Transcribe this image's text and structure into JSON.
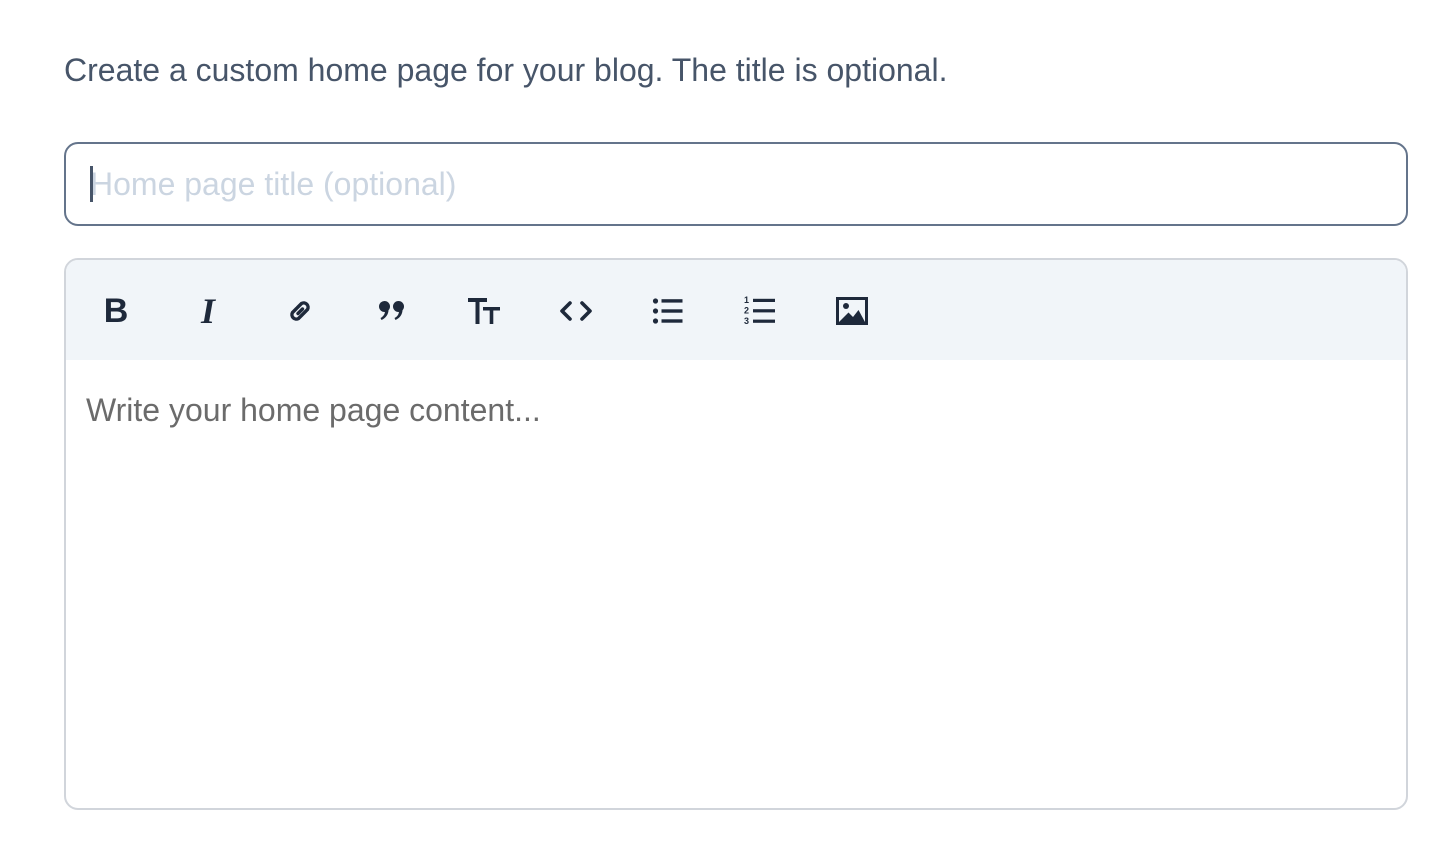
{
  "intro_text": "Create a custom home page for your blog. The title is optional.",
  "title_field": {
    "value": "",
    "placeholder": "Home page title (optional)"
  },
  "editor": {
    "toolbar": [
      {
        "name": "bold",
        "icon": "bold-icon",
        "glyph": "B"
      },
      {
        "name": "italic",
        "icon": "italic-icon",
        "glyph": "I"
      },
      {
        "name": "link",
        "icon": "link-icon"
      },
      {
        "name": "quote",
        "icon": "quote-icon"
      },
      {
        "name": "heading",
        "icon": "heading-icon"
      },
      {
        "name": "code",
        "icon": "code-icon"
      },
      {
        "name": "bullet-list",
        "icon": "bullet-list-icon"
      },
      {
        "name": "numbered-list",
        "icon": "numbered-list-icon"
      },
      {
        "name": "image",
        "icon": "image-icon"
      }
    ],
    "content_placeholder": "Write your home page content..."
  },
  "colors": {
    "text_muted": "#475569",
    "input_border": "#64748b",
    "toolbar_bg": "#f1f5f9",
    "icon": "#1e293b",
    "placeholder": "#cbd5e1"
  }
}
